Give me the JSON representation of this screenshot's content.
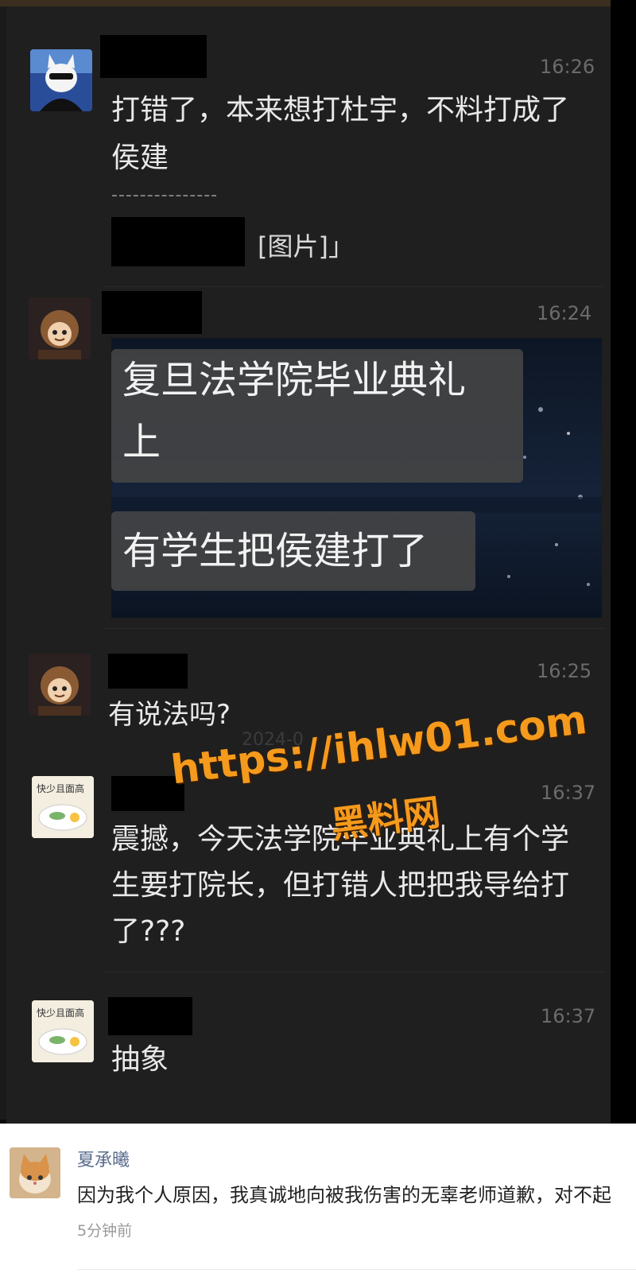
{
  "messages": [
    {
      "time": "16:26",
      "text_line1": "打错了，本来想打杜宇，不料打成了",
      "text_line2": "侯建",
      "separator": "---------------",
      "quote_suffix": "[图片]」"
    },
    {
      "time": "16:24",
      "caption1_line1": "复旦法学院毕业典礼",
      "caption1_line2": "上",
      "caption2": "有学生把侯建打了"
    },
    {
      "time": "16:25",
      "text": "有说法吗?"
    },
    {
      "time": "16:37",
      "text_line1": "震撼，今天法学院毕业典礼上有个学",
      "text_line2": "生要打院长，但打错人把把我导给打",
      "text_line3": "了???"
    },
    {
      "time": "16:37",
      "text": "抽象"
    }
  ],
  "watermark": {
    "url": "https://ihlw01.com",
    "name": "黑料网"
  },
  "faint_date": "2024-0",
  "comment": {
    "username": "夏承曦",
    "text": "因为我个人原因，我真诚地向被我伤害的无辜老师道歉，对不起",
    "time": "5分钟前"
  }
}
